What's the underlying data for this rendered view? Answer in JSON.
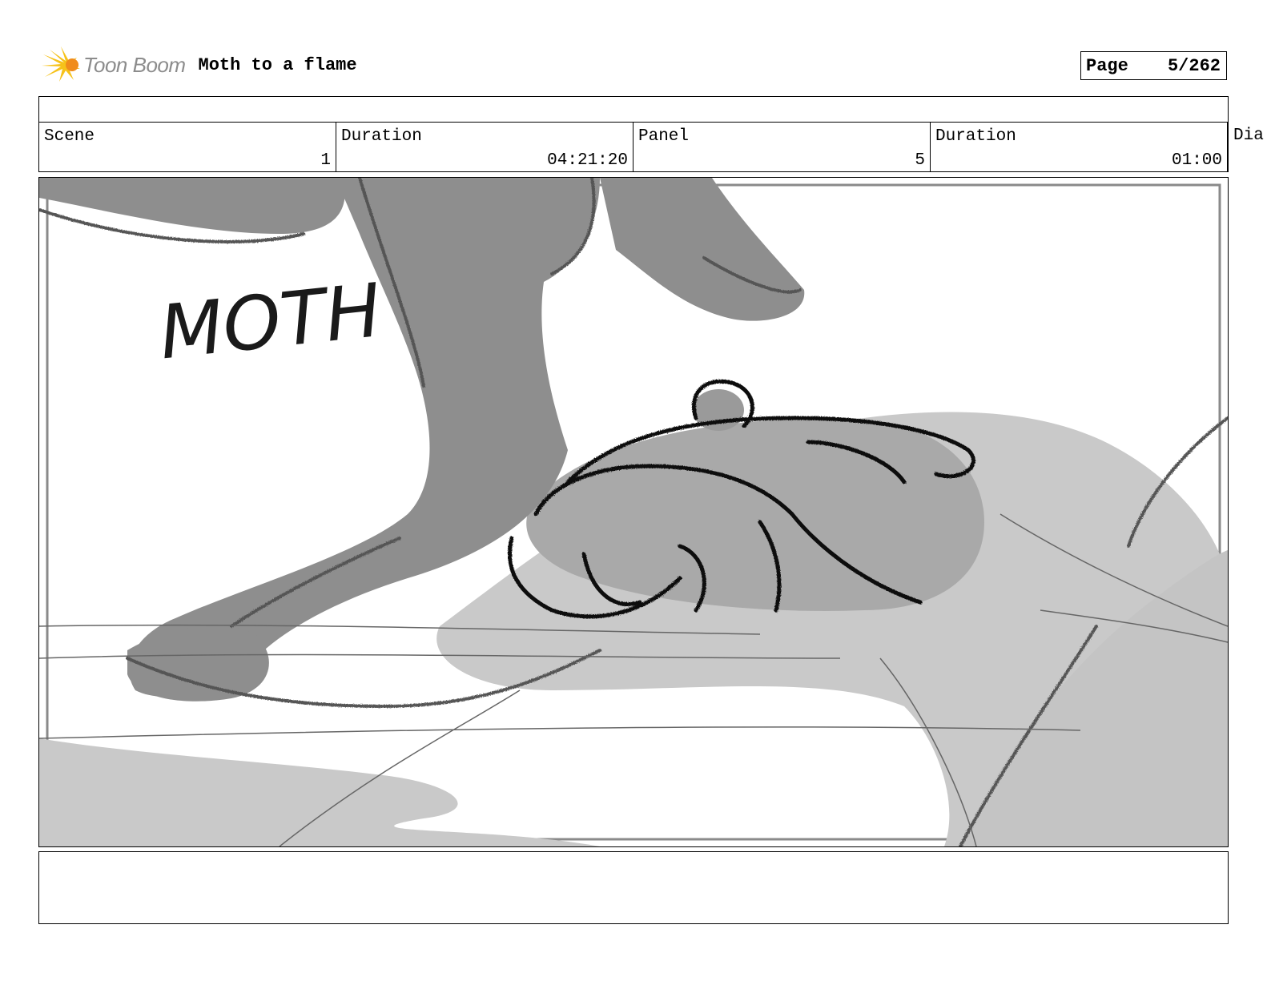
{
  "header": {
    "logo_text": "Toon Boom",
    "project_title": "Moth to a flame",
    "page_label": "Page",
    "page_number": "5/262"
  },
  "info": {
    "scene_label": "Scene",
    "scene_value": "1",
    "scene_duration_label": "Duration",
    "scene_duration_value": "04:21:20",
    "panel_label": "Panel",
    "panel_value": "5",
    "panel_duration_label": "Duration",
    "panel_duration_value": "01:00",
    "dialogue_label_partial": "Dia"
  },
  "panel": {
    "sketch_lettering": "MOTH",
    "colors": {
      "dark_gray": "#8f8f8f",
      "light_gray": "#c6c6c6",
      "line_black": "#111111",
      "frame_gray": "#8a8a8a"
    }
  },
  "icons": {
    "logo": "toon-boom-logo-icon"
  }
}
